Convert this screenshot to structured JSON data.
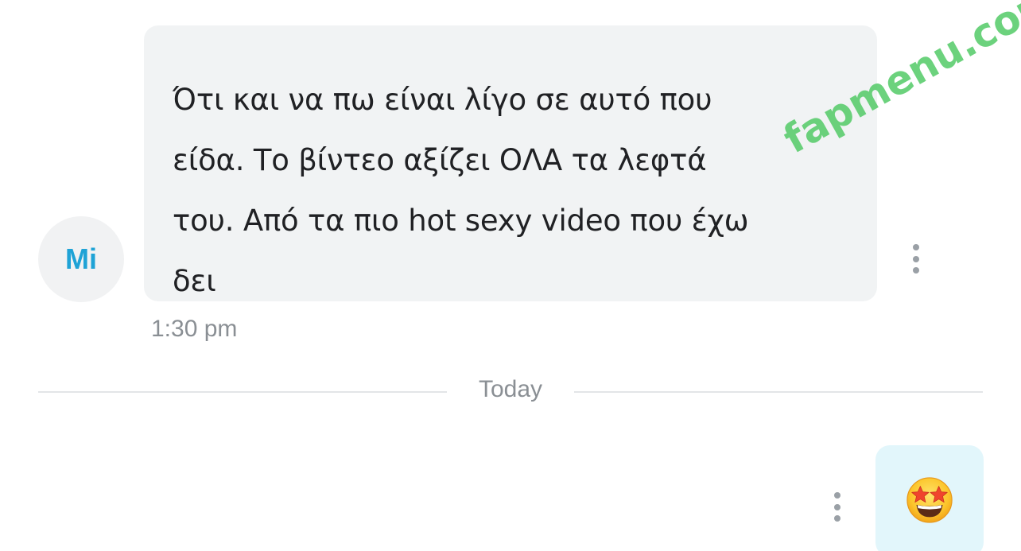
{
  "incoming_message": {
    "sender_initials": "Mi",
    "text": "Ότι και να πω είναι λίγο σε αυτό που\nείδα. Το βίντεο αξίζει ΟΛΑ τα λεφτά\nτου. Από τα πιο hot sexy video που έχω\nδει",
    "time": "1:30 pm",
    "menu_icon": "more-vertical-icon"
  },
  "day_divider": {
    "label": "Today"
  },
  "outgoing_message": {
    "emoji": "star-struck-emoji",
    "menu_icon": "more-vertical-icon"
  },
  "watermark": {
    "text": "fapmenu.com"
  },
  "colors": {
    "avatar_text": "#1fa3d6",
    "incoming_bubble": "#f1f3f4",
    "outgoing_bubble": "#e2f6fb",
    "meta_text": "#8a8f94",
    "watermark": "#4cc860"
  }
}
